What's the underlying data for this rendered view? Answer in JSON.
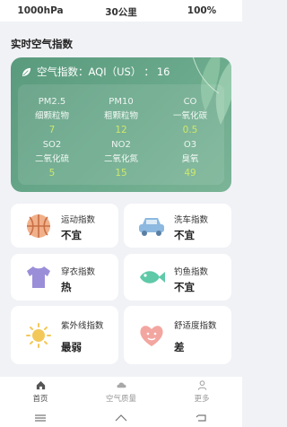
{
  "top_stats": [
    "1000hPa",
    "30公里",
    "100%"
  ],
  "section_title": "实时空气指数",
  "aqi": {
    "label": "空气指数：AQI（US）",
    "separator": "：",
    "value": "16",
    "pollutants": [
      {
        "code": "PM2.5",
        "name": "细颗粒物",
        "value": "7"
      },
      {
        "code": "PM10",
        "name": "粗颗粒物",
        "value": "12"
      },
      {
        "code": "CO",
        "name": "一氧化碳",
        "value": "0.5"
      },
      {
        "code": "SO2",
        "name": "二氧化硫",
        "value": "5"
      },
      {
        "code": "NO2",
        "name": "二氧化氮",
        "value": "15"
      },
      {
        "code": "O3",
        "name": "臭氧",
        "value": "49"
      }
    ]
  },
  "indices": [
    {
      "name": "运动指数",
      "value": "不宜",
      "icon": "basketball-icon"
    },
    {
      "name": "洗车指数",
      "value": "不宜",
      "icon": "car-icon"
    },
    {
      "name": "穿衣指数",
      "value": "热",
      "icon": "tshirt-icon"
    },
    {
      "name": "钓鱼指数",
      "value": "不宜",
      "icon": "fish-icon"
    },
    {
      "name": "紫外线指数",
      "value": "最弱",
      "icon": "sun-icon"
    },
    {
      "name": "舒适度指数",
      "value": "差",
      "icon": "face-icon"
    }
  ],
  "tabs": [
    {
      "label": "首页",
      "icon": "home-icon",
      "active": true
    },
    {
      "label": "空气质量",
      "icon": "air-quality-icon",
      "active": false
    },
    {
      "label": "更多",
      "icon": "person-icon",
      "active": false
    }
  ],
  "colors": {
    "card_green": "#6aa98b",
    "value_yellow": "#cde86a",
    "tile_orange": "#f0b08a",
    "tile_blue": "#8db8e0",
    "tile_purple": "#9b8ed8",
    "tile_teal": "#5fc9a8",
    "tile_sun": "#f3c85a",
    "tile_pink": "#f3a6a0"
  }
}
